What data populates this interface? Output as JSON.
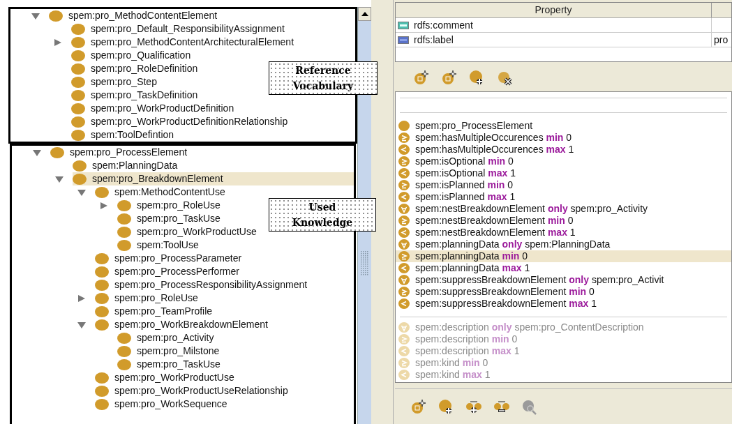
{
  "reference_tree": {
    "annotation": [
      "Reference",
      "Vocabulary"
    ],
    "nodes": [
      {
        "label": "spem:pro_MethodContentElement",
        "expanded": true,
        "selected": false,
        "children": [
          {
            "label": "spem:pro_Default_ResponsibilityAssignment",
            "selected": false
          },
          {
            "label": "spem:pro_MethodContentArchitecturalElement",
            "expanded": false,
            "selected": false
          },
          {
            "label": "spem:pro_Qualification",
            "selected": false
          },
          {
            "label": "spem:pro_RoleDefinition",
            "selected": false
          },
          {
            "label": "spem:pro_Step",
            "selected": false
          },
          {
            "label": "spem:pro_TaskDefinition",
            "selected": false
          },
          {
            "label": "spem:pro_WorkProductDefinition",
            "selected": false
          },
          {
            "label": "spem:pro_WorkProductDefinitionRelationship",
            "selected": false
          },
          {
            "label": "spem:ToolDefintion",
            "selected": false
          }
        ]
      }
    ]
  },
  "knowledge_tree": {
    "annotation": [
      "Used",
      "Knowledge"
    ],
    "nodes": [
      {
        "label": "spem:pro_ProcessElement",
        "expanded": true,
        "selected": false,
        "children": [
          {
            "label": "spem:PlanningData",
            "selected": false
          },
          {
            "label": "spem:pro_BreakdownElement",
            "expanded": true,
            "selected": true,
            "children": [
              {
                "label": "spem:MethodContentUse",
                "expanded": true,
                "selected": false,
                "children": [
                  {
                    "label": "spem:pro_RoleUse",
                    "expanded": false,
                    "selected": false
                  },
                  {
                    "label": "spem:pro_TaskUse",
                    "selected": false
                  },
                  {
                    "label": "spem:pro_WorkProductUse",
                    "selected": false
                  },
                  {
                    "label": "spem:ToolUse",
                    "selected": false
                  }
                ]
              },
              {
                "label": "spem:pro_ProcessParameter",
                "selected": false
              },
              {
                "label": "spem:pro_ProcessPerformer",
                "selected": false
              },
              {
                "label": "spem:pro_ProcessResponsibilityAssignment",
                "selected": false
              },
              {
                "label": "spem:pro_RoleUse",
                "expanded": false,
                "selected": false
              },
              {
                "label": "spem:pro_TeamProfile",
                "selected": false
              },
              {
                "label": "spem:pro_WorkBreakdownElement",
                "expanded": true,
                "selected": false,
                "children": [
                  {
                    "label": "spem:pro_Activity",
                    "selected": false
                  },
                  {
                    "label": "spem:pro_Milstone",
                    "selected": false
                  },
                  {
                    "label": "spem:pro_TaskUse",
                    "selected": false
                  }
                ]
              },
              {
                "label": "spem:pro_WorkProductUse",
                "selected": false
              },
              {
                "label": "spem:pro_WorkProductUseRelationship",
                "selected": false
              },
              {
                "label": "spem:pro_WorkSequence",
                "selected": false
              }
            ]
          }
        ]
      }
    ]
  },
  "annotations_table": {
    "columns": [
      "Property"
    ],
    "rows": [
      {
        "kind": "comment",
        "property": "rdfs:comment"
      },
      {
        "kind": "label",
        "property": "rdfs:label",
        "value": "pro"
      }
    ]
  },
  "superclasses": {
    "rows": [
      {
        "kind": "class",
        "property": "spem:pro_ProcessElement",
        "inherited": false,
        "selected": false
      },
      {
        "kind": "min",
        "property": "spem:hasMultipleOccurences",
        "keyword": "min",
        "value": "0",
        "inherited": false,
        "selected": false
      },
      {
        "kind": "max",
        "property": "spem:hasMultipleOccurences",
        "keyword": "max",
        "value": "1",
        "inherited": false,
        "selected": false
      },
      {
        "kind": "min",
        "property": "spem:isOptional",
        "keyword": "min",
        "value": "0",
        "inherited": false,
        "selected": false
      },
      {
        "kind": "max",
        "property": "spem:isOptional",
        "keyword": "max",
        "value": "1",
        "inherited": false,
        "selected": false
      },
      {
        "kind": "min",
        "property": "spem:isPlanned",
        "keyword": "min",
        "value": "0",
        "inherited": false,
        "selected": false
      },
      {
        "kind": "max",
        "property": "spem:isPlanned",
        "keyword": "max",
        "value": "1",
        "inherited": false,
        "selected": false
      },
      {
        "kind": "only",
        "property": "spem:nestBreakdownElement",
        "keyword": "only",
        "value": "spem:pro_Activity",
        "inherited": false,
        "selected": false
      },
      {
        "kind": "min",
        "property": "spem:nestBreakdownElement",
        "keyword": "min",
        "value": "0",
        "inherited": false,
        "selected": false
      },
      {
        "kind": "max",
        "property": "spem:nestBreakdownElement",
        "keyword": "max",
        "value": "1",
        "inherited": false,
        "selected": false
      },
      {
        "kind": "only",
        "property": "spem:planningData",
        "keyword": "only",
        "value": "spem:PlanningData",
        "inherited": false,
        "selected": false
      },
      {
        "kind": "min",
        "property": "spem:planningData",
        "keyword": "min",
        "value": "0",
        "inherited": false,
        "selected": true
      },
      {
        "kind": "max",
        "property": "spem:planningData",
        "keyword": "max",
        "value": "1",
        "inherited": false,
        "selected": false
      },
      {
        "kind": "only",
        "property": "spem:suppressBreakdownElement",
        "keyword": "only",
        "value": "spem:pro_Activit",
        "inherited": false,
        "selected": false
      },
      {
        "kind": "min",
        "property": "spem:suppressBreakdownElement",
        "keyword": "min",
        "value": "0",
        "inherited": false,
        "selected": false
      },
      {
        "kind": "max",
        "property": "spem:suppressBreakdownElement",
        "keyword": "max",
        "value": "1",
        "inherited": false,
        "selected": false
      }
    ],
    "inherited_rows": [
      {
        "kind": "only",
        "property": "spem:description",
        "keyword": "only",
        "value": "spem:pro_ContentDescription",
        "inherited": true,
        "selected": false
      },
      {
        "kind": "min",
        "property": "spem:description",
        "keyword": "min",
        "value": "0",
        "inherited": true,
        "selected": false
      },
      {
        "kind": "max",
        "property": "spem:description",
        "keyword": "max",
        "value": "1",
        "inherited": true,
        "selected": false
      },
      {
        "kind": "min",
        "property": "spem:kind",
        "keyword": "min",
        "value": "0",
        "inherited": true,
        "selected": false
      },
      {
        "kind": "max",
        "property": "spem:kind",
        "keyword": "max",
        "value": "1",
        "inherited": true,
        "selected": false
      }
    ]
  }
}
